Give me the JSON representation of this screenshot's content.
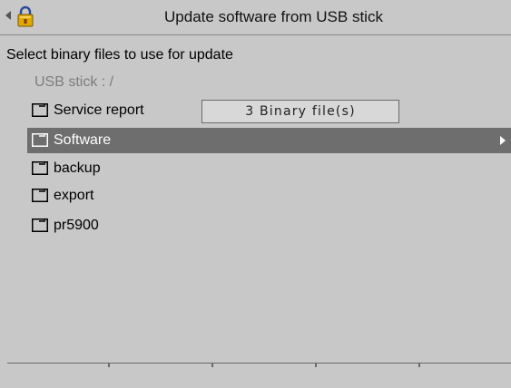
{
  "header": {
    "title": "Update software from USB stick",
    "back_icon": "left-arrow-icon",
    "status_icon": "lock-icon"
  },
  "main": {
    "heading": "Select binary files to use for update",
    "path_label": "USB stick : /",
    "info_box": "3 Binary file(s)",
    "items": [
      {
        "label": "Service report",
        "icon": "folder-icon",
        "selected": false
      },
      {
        "label": "Software",
        "icon": "folder-icon",
        "selected": true
      },
      {
        "label": "backup",
        "icon": "folder-icon",
        "selected": false
      },
      {
        "label": "export",
        "icon": "folder-icon",
        "selected": false
      },
      {
        "label": "pr5900",
        "icon": "folder-icon",
        "selected": false
      }
    ]
  },
  "softkeys": [
    "",
    "",
    "",
    "",
    ""
  ],
  "colors": {
    "background": "#c8c8c8",
    "selection": "#6e6e6e",
    "muted_text": "#7d7d7d",
    "lock_body": "#e0a800",
    "lock_shackle": "#2a4a9a"
  }
}
